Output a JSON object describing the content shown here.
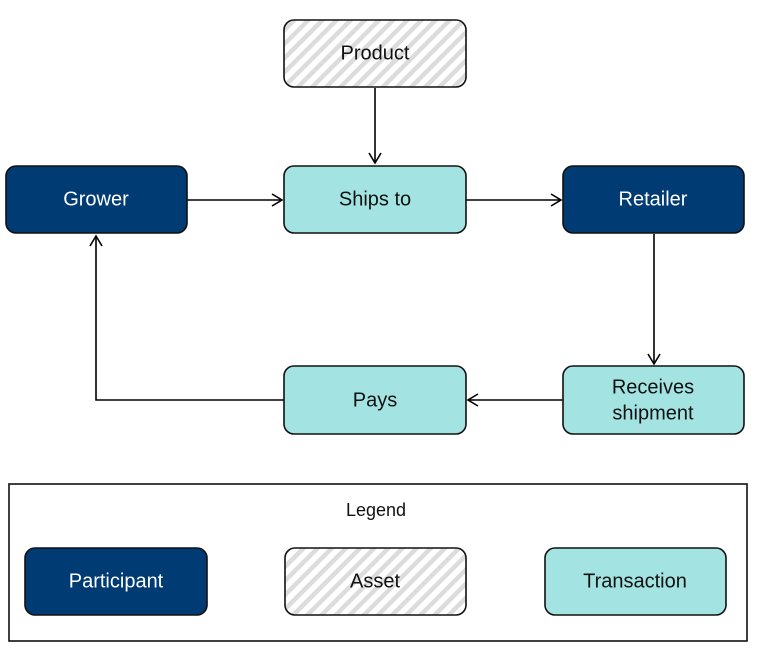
{
  "colors": {
    "participant": "#003B73",
    "transaction": "#A3E4E3",
    "asset_hatch": "#DCDCDC"
  },
  "nodes": {
    "product": {
      "label": "Product",
      "kind": "asset"
    },
    "grower": {
      "label": "Grower",
      "kind": "participant"
    },
    "ships_to": {
      "label": "Ships to",
      "kind": "transaction"
    },
    "retailer": {
      "label": "Retailer",
      "kind": "participant"
    },
    "pays": {
      "label": "Pays",
      "kind": "transaction"
    },
    "receives": {
      "label_line1": "Receives",
      "label_line2": "shipment",
      "kind": "transaction"
    }
  },
  "edges": [
    [
      "product",
      "ships_to"
    ],
    [
      "grower",
      "ships_to"
    ],
    [
      "ships_to",
      "retailer"
    ],
    [
      "retailer",
      "receives"
    ],
    [
      "receives",
      "pays"
    ],
    [
      "pays",
      "grower"
    ]
  ],
  "legend": {
    "title": "Legend",
    "participant": "Participant",
    "asset": "Asset",
    "transaction": "Transaction"
  }
}
